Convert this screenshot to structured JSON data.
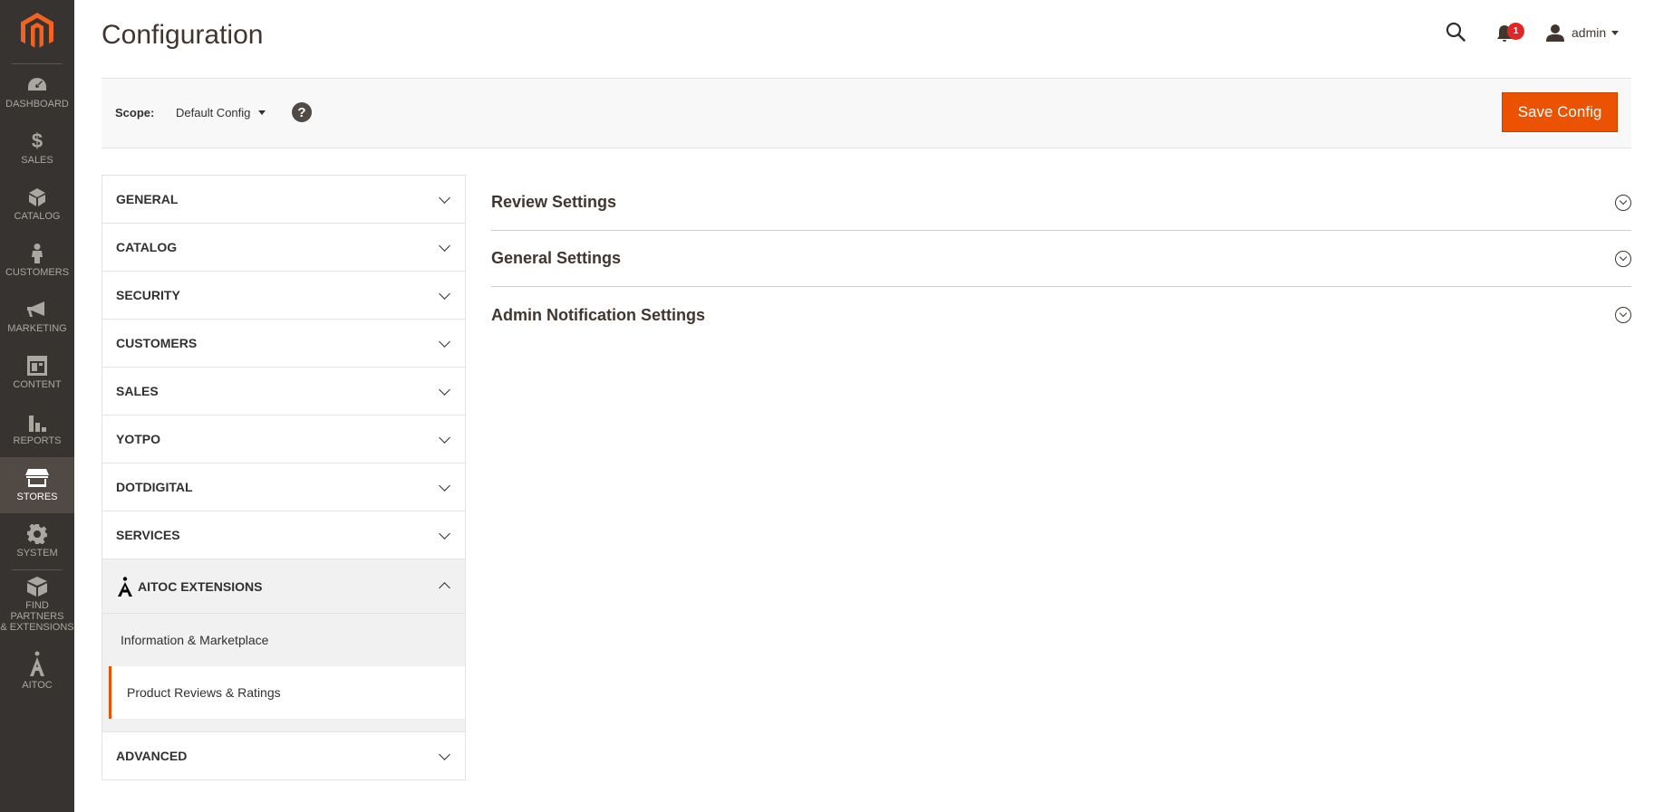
{
  "nav": {
    "items": [
      {
        "label": "DASHBOARD",
        "icon": "dashboard-icon"
      },
      {
        "label": "$",
        "icon": "dollar-icon"
      },
      {
        "label": "SALES",
        "icon": "dollar-icon"
      },
      {
        "label": "CATALOG",
        "icon": "box-icon"
      },
      {
        "label": "CUSTOMERS",
        "icon": "person-icon"
      },
      {
        "label": "MARKETING",
        "icon": "megaphone-icon"
      },
      {
        "label": "CONTENT",
        "icon": "layout-icon"
      },
      {
        "label": "REPORTS",
        "icon": "bar-chart-icon"
      },
      {
        "label": "STORES",
        "icon": "storefront-icon"
      },
      {
        "label": "SYSTEM",
        "icon": "gear-icon"
      },
      {
        "label": "FIND PARTNERS & EXTENSIONS",
        "icon": "blocks-icon"
      },
      {
        "label": "AITOC",
        "icon": "aitoc-icon"
      }
    ],
    "labels": {
      "dashboard": "DASHBOARD",
      "sales": "SALES",
      "catalog": "CATALOG",
      "customers": "CUSTOMERS",
      "marketing": "MARKETING",
      "content": "CONTENT",
      "reports": "REPORTS",
      "stores": "STORES",
      "system": "SYSTEM",
      "partners_line1": "FIND PARTNERS",
      "partners_line2": "& EXTENSIONS",
      "aitoc": "AITOC"
    }
  },
  "header": {
    "title": "Configuration",
    "notification_count": "1",
    "username": "admin"
  },
  "scope": {
    "label": "Scope:",
    "value": "Default Config",
    "help": "?",
    "save_label": "Save Config"
  },
  "tabs": {
    "general": "GENERAL",
    "catalog": "CATALOG",
    "security": "SECURITY",
    "customers": "CUSTOMERS",
    "sales": "SALES",
    "yotpo": "YOTPO",
    "dotdigital": "DOTDIGITAL",
    "services": "SERVICES",
    "aitoc": "AITOC EXTENSIONS",
    "aitoc_sub": [
      "Information & Marketplace",
      "Product Reviews & Ratings"
    ],
    "advanced": "ADVANCED"
  },
  "sections": [
    "Review Settings",
    "General Settings",
    "Admin Notification Settings"
  ],
  "colors": {
    "accent": "#eb5202",
    "nav_bg": "#373330",
    "nav_active": "#514943",
    "badge": "#e22626"
  }
}
